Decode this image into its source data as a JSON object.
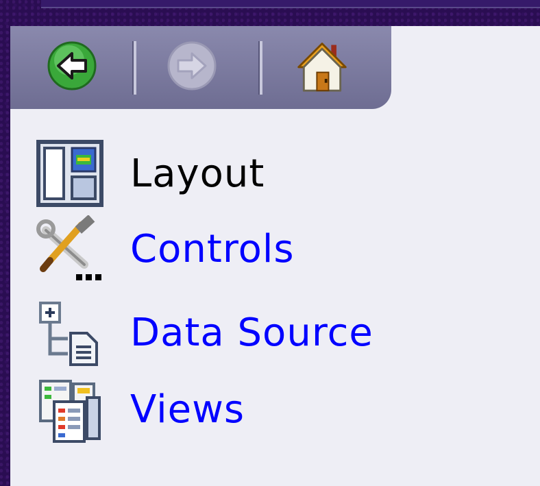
{
  "toolbar": {
    "back_icon": "back-arrow-icon",
    "forward_icon": "forward-arrow-icon",
    "home_icon": "home-icon"
  },
  "nav": {
    "items": [
      {
        "label": "Layout",
        "icon": "layout-icon",
        "color": "#000000"
      },
      {
        "label": "Controls",
        "icon": "tools-icon",
        "color": "#0000ff"
      },
      {
        "label": "Data Source",
        "icon": "data-source-icon",
        "color": "#0000ff"
      },
      {
        "label": "Views",
        "icon": "views-icon",
        "color": "#0000ff"
      }
    ]
  },
  "colors": {
    "background": "#2a0d52",
    "panel": "#eeeef5",
    "toolbar": "#7b7aa0",
    "link": "#0000ff",
    "active": "#000000"
  }
}
